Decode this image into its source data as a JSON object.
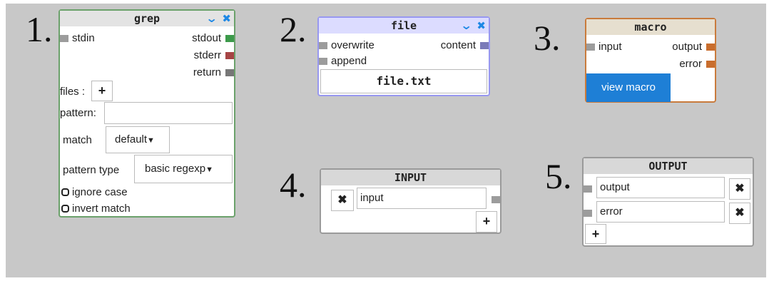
{
  "colors": {
    "canvas": "#c8c8c8",
    "grep_border": "#6ba16b",
    "file_border": "#9898f0",
    "file_header": "#dcdcff",
    "macro_border": "#c97b3c",
    "macro_header": "#e6dfcf",
    "io_header": "#d8d8d8",
    "port_gray": "#9c9c9c",
    "port_green": "#3c9a4a",
    "port_red": "#a64444",
    "port_darkgray": "#777777",
    "port_purple": "#7a7ab8",
    "port_orange": "#c96d2d",
    "accent_blue": "#1e88e5"
  },
  "labels": {
    "n1": "1.",
    "n2": "2.",
    "n3": "3.",
    "n4": "4.",
    "n5": "5."
  },
  "grep": {
    "title": "grep",
    "inputs": [
      "stdin"
    ],
    "outputs": [
      "stdout",
      "stderr",
      "return"
    ],
    "files_label": "files :",
    "add_glyph": "+",
    "pattern_label": "pattern:",
    "pattern_value": "",
    "match_label": "match",
    "match_value": "default",
    "pattern_type_label": "pattern type",
    "pattern_type_value": "basic regexp",
    "checkboxes": [
      "ignore case",
      "invert match"
    ],
    "icons": [
      "chevron-down-icon",
      "close-icon"
    ]
  },
  "file": {
    "title": "file",
    "inputs": [
      "overwrite",
      "append"
    ],
    "outputs": [
      "content"
    ],
    "filename": "file.txt"
  },
  "macro": {
    "title": "macro",
    "inputs": [
      "input"
    ],
    "outputs": [
      "output",
      "error"
    ],
    "button": "view macro"
  },
  "input_node": {
    "title": "INPUT",
    "fields": [
      "input"
    ],
    "remove_glyph": "✖",
    "add_glyph": "+"
  },
  "output_node": {
    "title": "OUTPUT",
    "fields": [
      "output",
      "error"
    ],
    "remove_glyph": "✖",
    "add_glyph": "+"
  }
}
